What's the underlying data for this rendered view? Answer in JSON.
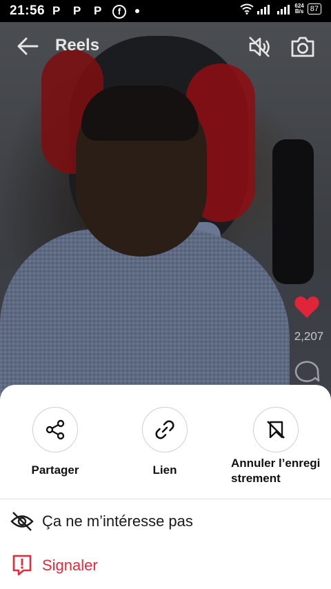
{
  "status_bar": {
    "time": "21:56",
    "app_icons": [
      "P",
      "P",
      "P"
    ],
    "network_speed_value": "624",
    "network_speed_unit": "B/s",
    "battery": "87"
  },
  "header": {
    "title": "Reels"
  },
  "reel": {
    "like_count": "2,207",
    "heart_color": "#e0243a"
  },
  "sheet": {
    "actions": [
      {
        "label": "Partager",
        "icon": "share-icon"
      },
      {
        "label": "Lien",
        "icon": "link-icon"
      },
      {
        "label": "Annuler l’enregistrement",
        "icon": "unsave-bookmark-icon"
      }
    ],
    "menu": [
      {
        "label": "Ça ne m’intéresse pas",
        "icon": "eye-off-icon"
      },
      {
        "label": "Signaler",
        "icon": "report-icon",
        "color": "#e8293a"
      }
    ]
  }
}
